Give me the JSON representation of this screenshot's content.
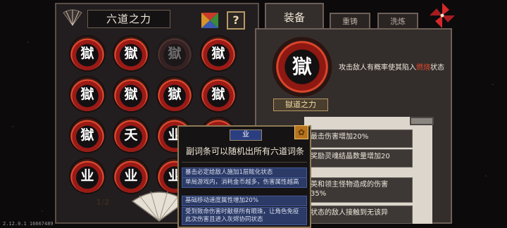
{
  "left_panel": {
    "title": "六道之力",
    "help_label": "?",
    "page_indicator": "1/2",
    "runes": [
      {
        "char": "獄",
        "dim": false
      },
      {
        "char": "獄",
        "dim": false
      },
      {
        "char": "獄",
        "dim": true
      },
      {
        "char": "獄",
        "dim": false
      },
      {
        "char": "獄",
        "dim": false
      },
      {
        "char": "獄",
        "dim": false
      },
      {
        "char": "獄",
        "dim": false
      },
      {
        "char": "獄",
        "dim": false
      },
      {
        "char": "獄",
        "dim": false
      },
      {
        "char": "夭",
        "dim": false
      },
      {
        "char": "业",
        "dim": false
      },
      {
        "char": "业",
        "dim": false
      },
      {
        "char": "业",
        "dim": false
      },
      {
        "char": "业",
        "dim": false
      },
      {
        "char": "业",
        "dim": false
      }
    ]
  },
  "right_panel": {
    "tabs": {
      "equip": "装备",
      "reforge": "重铸",
      "refine": "洗炼"
    },
    "emblem_char": "獄",
    "emblem_name": "獄道之力",
    "effect_prefix": "攻击敌人有概率使其陷入",
    "effect_highlight": "燃烧",
    "effect_suffix": "状态",
    "list": [
      "最击伤害增加20%",
      "奖励灵魂结晶数量增加20",
      "英和领主怪物造成的伤害\n35%",
      "状态的敌人接触到无该异"
    ]
  },
  "tooltip": {
    "badge": "业",
    "corner_icon": "gear-icon",
    "title": "副词条可以随机出所有六道词条",
    "rows": [
      "暴击必定给敌人施加1层眩化状态",
      "单局游戏内，消耗金币越多，伤害属性越高",
      "基础移动速度属性增加20%",
      "受到致命伤害时献祭所有眼珠，让角色免疫此次伤害且进入灰烬协同状态"
    ]
  },
  "version": "2.12.0.1 16667489",
  "colors": {
    "rune_red": "#9a1a16",
    "highlight_red": "#e2482e",
    "tooltip_blue": "#2b3a66",
    "gold_border": "#b79a66"
  }
}
